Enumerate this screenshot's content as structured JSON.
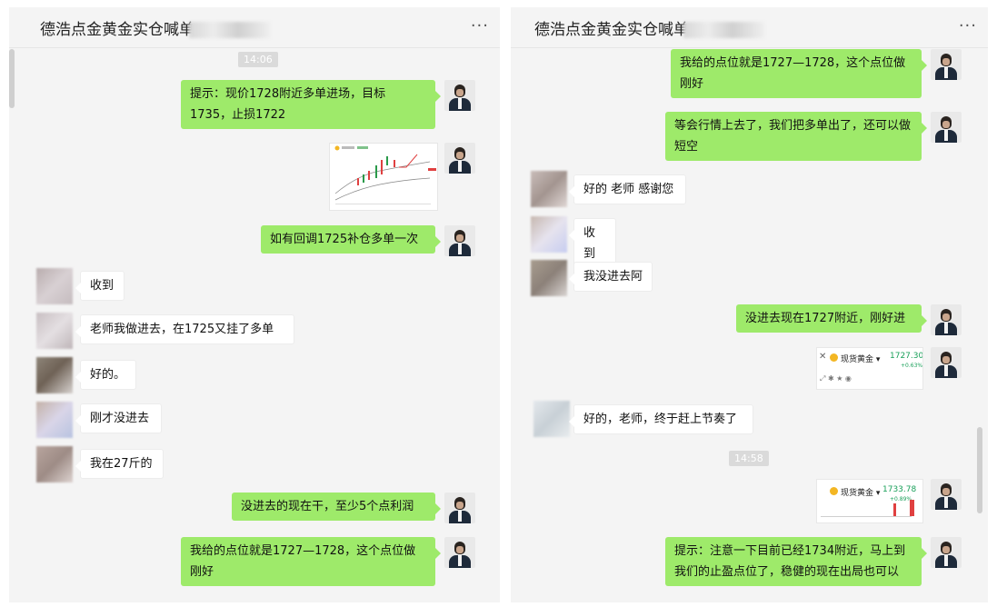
{
  "left_panel": {
    "title": "德浩点金黄金实仓喊单",
    "more_label": "···",
    "timestamp": "14:06",
    "messages": [
      "提示：现价1728附近多单进场，目标1735，止损1722",
      "如有回调1725补仓多单一次",
      "收到",
      "老师我做进去，在1725又挂了多单",
      "好的。",
      "刚才没进去",
      "我在27斤的",
      "没进去的现在干，至少5个点利润",
      "我给的点位就是1727—1728，这个点位做刚好"
    ]
  },
  "right_panel": {
    "title": "德浩点金黄金实仓喊单",
    "more_label": "···",
    "timestamp": "14:58",
    "messages": [
      "我给的点位就是1727—1728，这个点位做刚好",
      "等会行情上去了，我们把多单出了，还可以做短空",
      "好的 老师 感谢您",
      "收到",
      "我没进去阿",
      "没进去现在1727附近，刚好进",
      "好的，老师，终于赶上节奏了",
      "提示：注意一下目前已经1734附近，马上到我们的止盈点位了，稳健的现在出局也可以"
    ],
    "quote_card_1": {
      "name": "现货黄金 ▾",
      "price": "1727.30",
      "change": "+0.63%"
    },
    "quote_card_2": {
      "name": "现货黄金 ▾",
      "price": "1733.78",
      "change": "+0.89%"
    }
  },
  "colors": {
    "sent_bubble": "#9eea6a",
    "received_bubble": "#ffffff",
    "background": "#f4f4f4"
  }
}
